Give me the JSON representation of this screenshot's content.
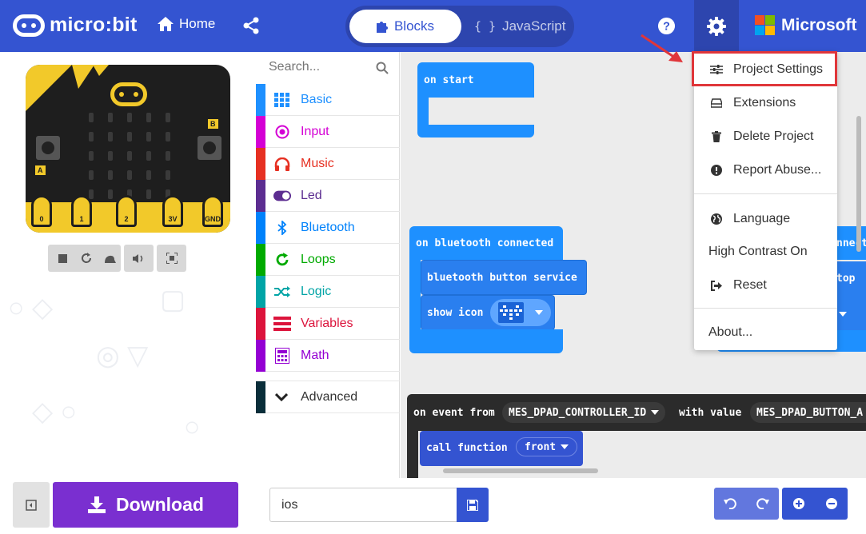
{
  "header": {
    "logo_text": "micro:bit",
    "home_label": "Home",
    "blocks_label": "Blocks",
    "javascript_label": "JavaScript",
    "javascript_brace": "{ }",
    "microsoft_label": "Microsoft"
  },
  "simulator": {
    "button_a_label": "A",
    "button_b_label": "B",
    "pins": [
      "0",
      "1",
      "2",
      "3V",
      "GND"
    ]
  },
  "toolbox": {
    "search_placeholder": "Search...",
    "categories": [
      {
        "label": "Basic",
        "color": "#1e90ff"
      },
      {
        "label": "Input",
        "color": "#d400d4"
      },
      {
        "label": "Music",
        "color": "#e63022"
      },
      {
        "label": "Led",
        "color": "#5c2d91"
      },
      {
        "label": "Bluetooth",
        "color": "#0082fb"
      },
      {
        "label": "Loops",
        "color": "#00aa00"
      },
      {
        "label": "Logic",
        "color": "#00a4a6"
      },
      {
        "label": "Variables",
        "color": "#dc143c"
      },
      {
        "label": "Math",
        "color": "#9400d3"
      }
    ],
    "advanced_label": "Advanced"
  },
  "workspace": {
    "on_start": "on start",
    "bt_connected": "on bluetooth connected",
    "bt_button_service": "bluetooth button service",
    "show_icon": "show icon",
    "event_from": "on event from",
    "controller_id": "MES_DPAD_CONTROLLER_ID",
    "with_value": "with value",
    "button_value": "MES_DPAD_BUTTON_A",
    "call_function": "call function",
    "function_name": "front",
    "partial_1": "nnect",
    "partial_2": "top"
  },
  "settings_menu": {
    "items": [
      {
        "label": "Project Settings",
        "icon": "sliders-icon"
      },
      {
        "label": "Extensions",
        "icon": "drive-icon"
      },
      {
        "label": "Delete Project",
        "icon": "trash-icon"
      },
      {
        "label": "Report Abuse...",
        "icon": "exclamation-circle-icon"
      },
      {
        "label": "Language",
        "icon": "globe-icon"
      },
      {
        "label": "High Contrast On",
        "icon": ""
      },
      {
        "label": "Reset",
        "icon": "sign-out-icon"
      },
      {
        "label": "About...",
        "icon": ""
      }
    ]
  },
  "bottom": {
    "download_label": "Download",
    "project_name": "ios"
  }
}
